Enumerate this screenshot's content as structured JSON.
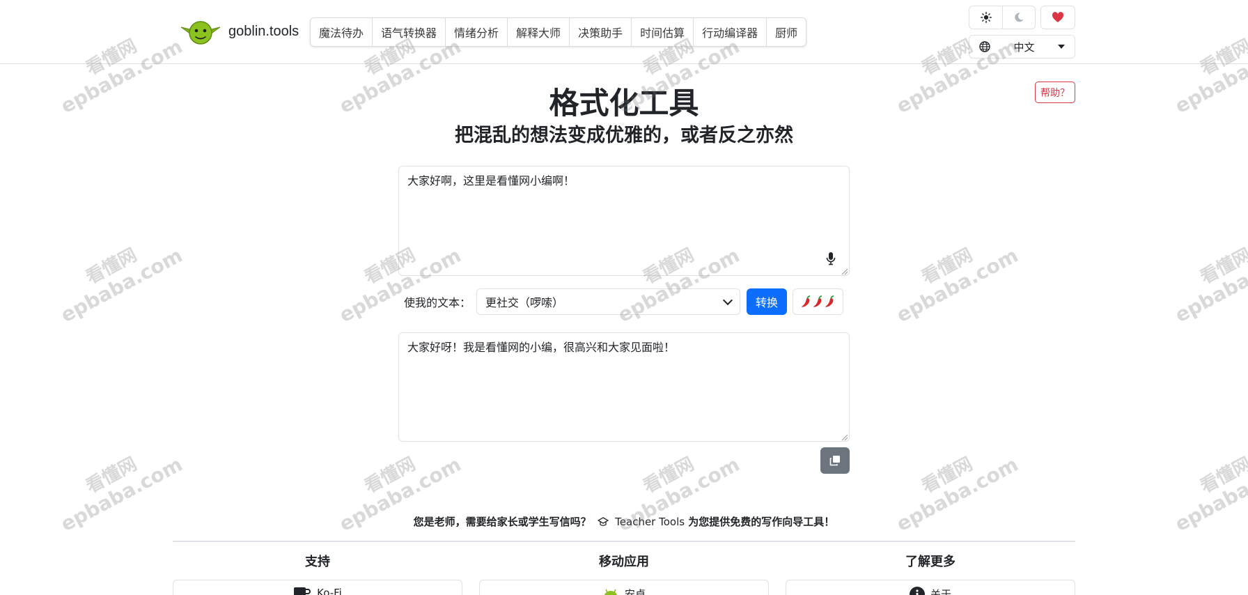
{
  "brand": {
    "name": "goblin.tools"
  },
  "nav": {
    "items": [
      "魔法待办",
      "语气转换器",
      "情绪分析",
      "解释大师",
      "决策助手",
      "时间估算",
      "行动编译器",
      "厨师"
    ]
  },
  "header": {
    "language": "中文",
    "help_label": "帮助？",
    "icons": {
      "light": "sun-icon",
      "dark": "moon-icon",
      "support": "heart-icon",
      "language": "globe-icon"
    }
  },
  "main": {
    "title": "格式化工具",
    "subtitle": "把混乱的想法变成优雅的，或者反之亦然",
    "input_text": "大家好啊，这里是看懂网小编啊！",
    "control_label": "使我的文本：",
    "mode_value": "更社交（啰嗦）",
    "convert_label": "转换",
    "spice_icons": "chili-pepper-icon",
    "output_text": "大家好呀！我是看懂网的小编，很高兴和大家见面啦！"
  },
  "promo": {
    "lead": "您是老师，需要给家长或学生写信吗？",
    "link": "Teacher Tools",
    "tail": "为您提供免费的写作向导工具！"
  },
  "footer": {
    "columns": [
      {
        "heading": "支持",
        "card_label": "Ko-Fi"
      },
      {
        "heading": "移动应用",
        "card_label": "安卓"
      },
      {
        "heading": "了解更多",
        "card_label": "关于"
      }
    ]
  },
  "watermark": {
    "line1": "看懂网",
    "line2": "epbaba.com"
  },
  "colors": {
    "primary": "#0d6efd",
    "danger": "#dc3545",
    "secondary": "#6c757d",
    "border": "#dee2e6",
    "logo_green": "#8cc21f"
  }
}
